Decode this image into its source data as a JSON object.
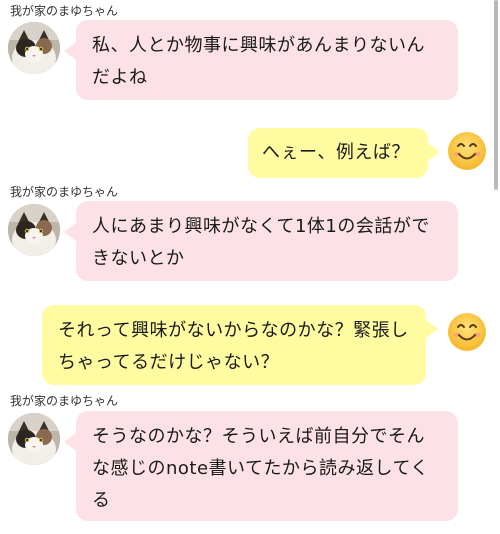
{
  "chat": {
    "messages": [
      {
        "sender": "我が家のまゆちゃん",
        "side": "left",
        "text": "私、人とか物事に興味があんまりないんだよね"
      },
      {
        "side": "right",
        "text": "へぇー、例えば？",
        "avatar_icon": "smiling-face-icon"
      },
      {
        "sender": "我が家のまゆちゃん",
        "side": "left",
        "text": "人にあまり興味がなくて1体1の会話ができないとか"
      },
      {
        "side": "right",
        "text": "それって興味がないからなのかな？緊張しちゃってるだけじゃない？",
        "avatar_icon": "smiling-face-icon"
      },
      {
        "sender": "我が家のまゆちゃん",
        "side": "left",
        "text": "そうなのかな？そういえば前自分でそんな感じのnote書いてたから読み返してくる"
      }
    ]
  },
  "colors": {
    "left_bubble": "#fce1e6",
    "right_bubble": "#fffba0",
    "background": "#ffffff"
  }
}
